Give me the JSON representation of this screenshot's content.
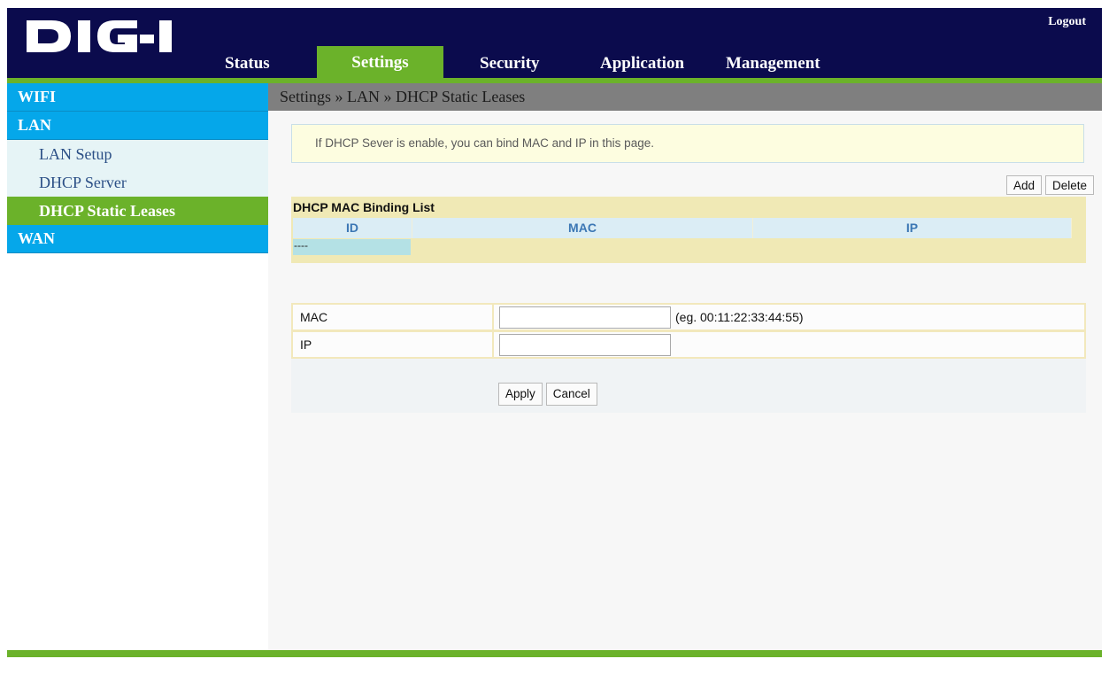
{
  "header": {
    "logo_text": "DIGI",
    "logout_label": "Logout",
    "colors": {
      "header_bg": "#0b0b4d",
      "accent_green": "#6bb22a",
      "accent_blue": "#05a7ea"
    }
  },
  "nav": {
    "items": [
      {
        "label": "Status",
        "active": false
      },
      {
        "label": "Settings",
        "active": true
      },
      {
        "label": "Security",
        "active": false
      },
      {
        "label": "Application",
        "active": false
      },
      {
        "label": "Management",
        "active": false
      }
    ]
  },
  "sidebar": {
    "sections": [
      {
        "label": "WIFI"
      },
      {
        "label": "LAN",
        "items": [
          {
            "label": "LAN Setup",
            "active": false
          },
          {
            "label": "DHCP Server",
            "active": false
          },
          {
            "label": "DHCP Static Leases",
            "active": true
          }
        ]
      },
      {
        "label": "WAN"
      }
    ]
  },
  "main": {
    "breadcrumb": "Settings » LAN » DHCP Static Leases",
    "info_text": "If DHCP Sever is enable, you can bind MAC and IP in this page.",
    "add_label": "Add",
    "delete_label": "Delete",
    "list": {
      "title": "DHCP MAC Binding List",
      "columns": [
        "ID",
        "MAC",
        "IP"
      ],
      "empty_row": "----"
    },
    "form": {
      "mac_label": "MAC",
      "mac_value": "",
      "mac_hint": "(eg. 00:11:22:33:44:55)",
      "ip_label": "IP",
      "ip_value": "",
      "apply_label": "Apply",
      "cancel_label": "Cancel"
    }
  }
}
